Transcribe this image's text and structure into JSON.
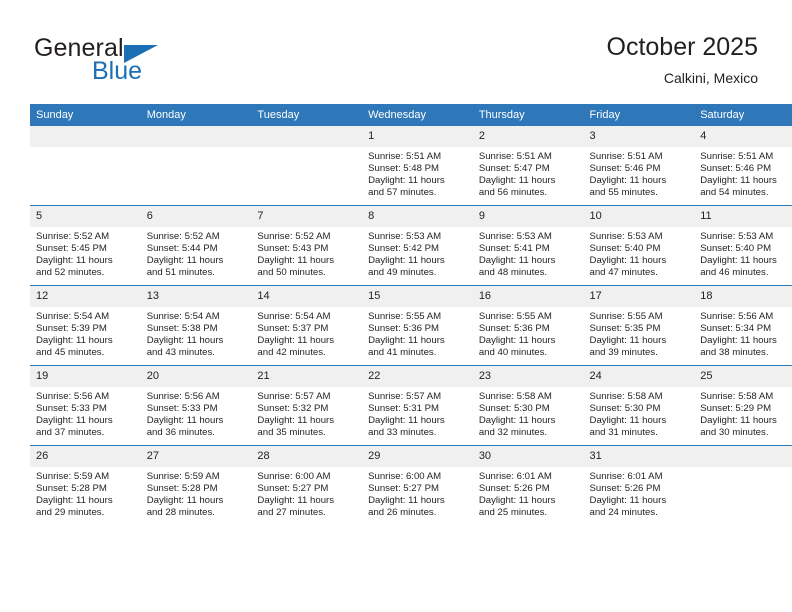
{
  "brand": {
    "name_part1": "General",
    "name_part2": "Blue",
    "accent_color": "#1b6fb5"
  },
  "header": {
    "title": "October 2025",
    "subtitle": "Calkini, Mexico"
  },
  "calendar": {
    "header_color": "#2e77b8",
    "daynum_bg": "#f0f0f0",
    "weekday_headers": [
      "Sunday",
      "Monday",
      "Tuesday",
      "Wednesday",
      "Thursday",
      "Friday",
      "Saturday"
    ],
    "weeks": [
      [
        {
          "day": "",
          "sunrise": "",
          "sunset": "",
          "daylight_line1": "",
          "daylight_line2": ""
        },
        {
          "day": "",
          "sunrise": "",
          "sunset": "",
          "daylight_line1": "",
          "daylight_line2": ""
        },
        {
          "day": "",
          "sunrise": "",
          "sunset": "",
          "daylight_line1": "",
          "daylight_line2": ""
        },
        {
          "day": "1",
          "sunrise": "Sunrise: 5:51 AM",
          "sunset": "Sunset: 5:48 PM",
          "daylight_line1": "Daylight: 11 hours",
          "daylight_line2": "and 57 minutes."
        },
        {
          "day": "2",
          "sunrise": "Sunrise: 5:51 AM",
          "sunset": "Sunset: 5:47 PM",
          "daylight_line1": "Daylight: 11 hours",
          "daylight_line2": "and 56 minutes."
        },
        {
          "day": "3",
          "sunrise": "Sunrise: 5:51 AM",
          "sunset": "Sunset: 5:46 PM",
          "daylight_line1": "Daylight: 11 hours",
          "daylight_line2": "and 55 minutes."
        },
        {
          "day": "4",
          "sunrise": "Sunrise: 5:51 AM",
          "sunset": "Sunset: 5:46 PM",
          "daylight_line1": "Daylight: 11 hours",
          "daylight_line2": "and 54 minutes."
        }
      ],
      [
        {
          "day": "5",
          "sunrise": "Sunrise: 5:52 AM",
          "sunset": "Sunset: 5:45 PM",
          "daylight_line1": "Daylight: 11 hours",
          "daylight_line2": "and 52 minutes."
        },
        {
          "day": "6",
          "sunrise": "Sunrise: 5:52 AM",
          "sunset": "Sunset: 5:44 PM",
          "daylight_line1": "Daylight: 11 hours",
          "daylight_line2": "and 51 minutes."
        },
        {
          "day": "7",
          "sunrise": "Sunrise: 5:52 AM",
          "sunset": "Sunset: 5:43 PM",
          "daylight_line1": "Daylight: 11 hours",
          "daylight_line2": "and 50 minutes."
        },
        {
          "day": "8",
          "sunrise": "Sunrise: 5:53 AM",
          "sunset": "Sunset: 5:42 PM",
          "daylight_line1": "Daylight: 11 hours",
          "daylight_line2": "and 49 minutes."
        },
        {
          "day": "9",
          "sunrise": "Sunrise: 5:53 AM",
          "sunset": "Sunset: 5:41 PM",
          "daylight_line1": "Daylight: 11 hours",
          "daylight_line2": "and 48 minutes."
        },
        {
          "day": "10",
          "sunrise": "Sunrise: 5:53 AM",
          "sunset": "Sunset: 5:40 PM",
          "daylight_line1": "Daylight: 11 hours",
          "daylight_line2": "and 47 minutes."
        },
        {
          "day": "11",
          "sunrise": "Sunrise: 5:53 AM",
          "sunset": "Sunset: 5:40 PM",
          "daylight_line1": "Daylight: 11 hours",
          "daylight_line2": "and 46 minutes."
        }
      ],
      [
        {
          "day": "12",
          "sunrise": "Sunrise: 5:54 AM",
          "sunset": "Sunset: 5:39 PM",
          "daylight_line1": "Daylight: 11 hours",
          "daylight_line2": "and 45 minutes."
        },
        {
          "day": "13",
          "sunrise": "Sunrise: 5:54 AM",
          "sunset": "Sunset: 5:38 PM",
          "daylight_line1": "Daylight: 11 hours",
          "daylight_line2": "and 43 minutes."
        },
        {
          "day": "14",
          "sunrise": "Sunrise: 5:54 AM",
          "sunset": "Sunset: 5:37 PM",
          "daylight_line1": "Daylight: 11 hours",
          "daylight_line2": "and 42 minutes."
        },
        {
          "day": "15",
          "sunrise": "Sunrise: 5:55 AM",
          "sunset": "Sunset: 5:36 PM",
          "daylight_line1": "Daylight: 11 hours",
          "daylight_line2": "and 41 minutes."
        },
        {
          "day": "16",
          "sunrise": "Sunrise: 5:55 AM",
          "sunset": "Sunset: 5:36 PM",
          "daylight_line1": "Daylight: 11 hours",
          "daylight_line2": "and 40 minutes."
        },
        {
          "day": "17",
          "sunrise": "Sunrise: 5:55 AM",
          "sunset": "Sunset: 5:35 PM",
          "daylight_line1": "Daylight: 11 hours",
          "daylight_line2": "and 39 minutes."
        },
        {
          "day": "18",
          "sunrise": "Sunrise: 5:56 AM",
          "sunset": "Sunset: 5:34 PM",
          "daylight_line1": "Daylight: 11 hours",
          "daylight_line2": "and 38 minutes."
        }
      ],
      [
        {
          "day": "19",
          "sunrise": "Sunrise: 5:56 AM",
          "sunset": "Sunset: 5:33 PM",
          "daylight_line1": "Daylight: 11 hours",
          "daylight_line2": "and 37 minutes."
        },
        {
          "day": "20",
          "sunrise": "Sunrise: 5:56 AM",
          "sunset": "Sunset: 5:33 PM",
          "daylight_line1": "Daylight: 11 hours",
          "daylight_line2": "and 36 minutes."
        },
        {
          "day": "21",
          "sunrise": "Sunrise: 5:57 AM",
          "sunset": "Sunset: 5:32 PM",
          "daylight_line1": "Daylight: 11 hours",
          "daylight_line2": "and 35 minutes."
        },
        {
          "day": "22",
          "sunrise": "Sunrise: 5:57 AM",
          "sunset": "Sunset: 5:31 PM",
          "daylight_line1": "Daylight: 11 hours",
          "daylight_line2": "and 33 minutes."
        },
        {
          "day": "23",
          "sunrise": "Sunrise: 5:58 AM",
          "sunset": "Sunset: 5:30 PM",
          "daylight_line1": "Daylight: 11 hours",
          "daylight_line2": "and 32 minutes."
        },
        {
          "day": "24",
          "sunrise": "Sunrise: 5:58 AM",
          "sunset": "Sunset: 5:30 PM",
          "daylight_line1": "Daylight: 11 hours",
          "daylight_line2": "and 31 minutes."
        },
        {
          "day": "25",
          "sunrise": "Sunrise: 5:58 AM",
          "sunset": "Sunset: 5:29 PM",
          "daylight_line1": "Daylight: 11 hours",
          "daylight_line2": "and 30 minutes."
        }
      ],
      [
        {
          "day": "26",
          "sunrise": "Sunrise: 5:59 AM",
          "sunset": "Sunset: 5:28 PM",
          "daylight_line1": "Daylight: 11 hours",
          "daylight_line2": "and 29 minutes."
        },
        {
          "day": "27",
          "sunrise": "Sunrise: 5:59 AM",
          "sunset": "Sunset: 5:28 PM",
          "daylight_line1": "Daylight: 11 hours",
          "daylight_line2": "and 28 minutes."
        },
        {
          "day": "28",
          "sunrise": "Sunrise: 6:00 AM",
          "sunset": "Sunset: 5:27 PM",
          "daylight_line1": "Daylight: 11 hours",
          "daylight_line2": "and 27 minutes."
        },
        {
          "day": "29",
          "sunrise": "Sunrise: 6:00 AM",
          "sunset": "Sunset: 5:27 PM",
          "daylight_line1": "Daylight: 11 hours",
          "daylight_line2": "and 26 minutes."
        },
        {
          "day": "30",
          "sunrise": "Sunrise: 6:01 AM",
          "sunset": "Sunset: 5:26 PM",
          "daylight_line1": "Daylight: 11 hours",
          "daylight_line2": "and 25 minutes."
        },
        {
          "day": "31",
          "sunrise": "Sunrise: 6:01 AM",
          "sunset": "Sunset: 5:26 PM",
          "daylight_line1": "Daylight: 11 hours",
          "daylight_line2": "and 24 minutes."
        },
        {
          "day": "",
          "sunrise": "",
          "sunset": "",
          "daylight_line1": "",
          "daylight_line2": ""
        }
      ]
    ]
  }
}
